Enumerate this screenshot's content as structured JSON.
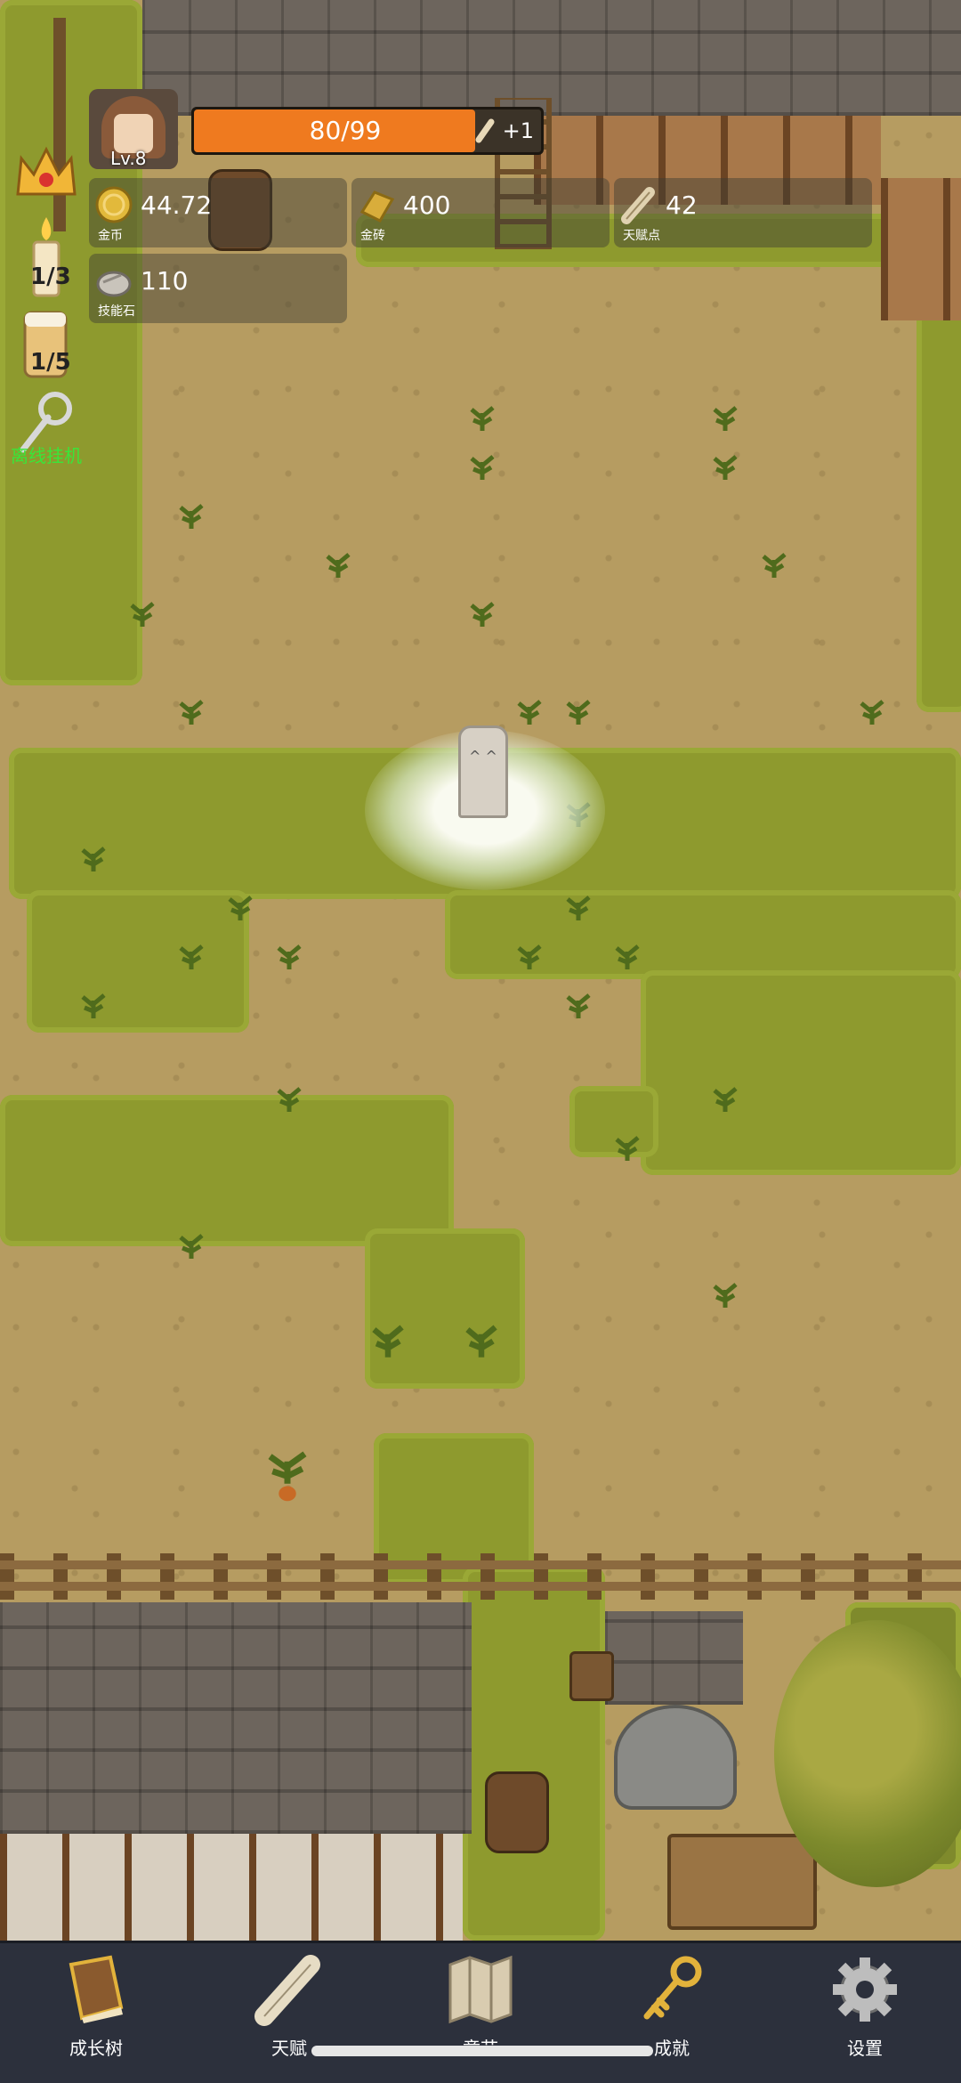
{
  "player": {
    "level": "Lv.8",
    "hp_text": "80/99",
    "hp_fraction": 0.81,
    "hp_bonus": "+1"
  },
  "resources": [
    {
      "icon": "gold-coin-icon",
      "value": "44.72",
      "label": "金币"
    },
    {
      "icon": "gold-brick-icon",
      "value": "400",
      "label": "金砖"
    },
    {
      "icon": "talent-scroll-icon",
      "value": "42",
      "label": "天赋点"
    },
    {
      "icon": "skill-stone-icon",
      "value": "110",
      "label": "技能石"
    }
  ],
  "side_panel": {
    "candle_count": "1/3",
    "drink_count": "1/5",
    "idle_label": "离线挂机"
  },
  "nav": [
    {
      "icon": "book-icon",
      "label": "成长树"
    },
    {
      "icon": "scroll-icon",
      "label": "天赋"
    },
    {
      "icon": "map-icon",
      "label": "章节"
    },
    {
      "icon": "key-icon",
      "label": "成就"
    },
    {
      "icon": "gear-icon",
      "label": "设置"
    }
  ],
  "colors": {
    "hp_fill": "#ef7a1f",
    "grass": "#8e9a2e",
    "dirt": "#b69c61",
    "navbar": "#2c303c",
    "idle_label": "#39e639"
  }
}
